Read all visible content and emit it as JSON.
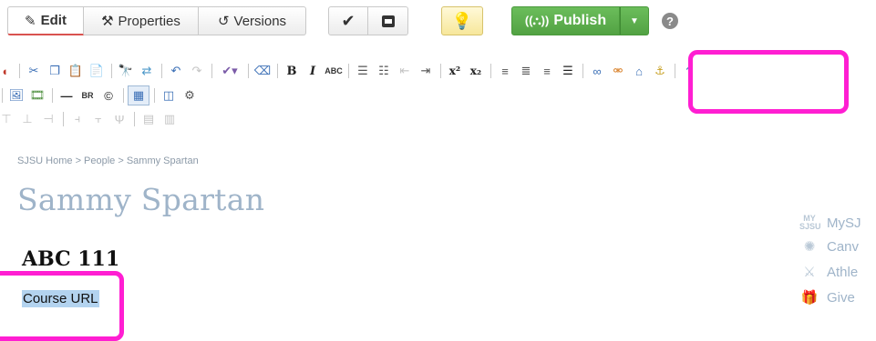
{
  "topbar": {
    "edit_label": "Edit",
    "properties_label": "Properties",
    "versions_label": "Versions",
    "publish_label": "Publish",
    "help_glyph": "?"
  },
  "icons": {
    "edit": "pencil-icon",
    "properties": "tools-icon",
    "versions": "history-icon",
    "confirm": "checkmark-icon",
    "save": "save-draft-icon",
    "suggest": "lightbulb-icon",
    "publish": "broadcast-icon",
    "publish_menu": "chevron-down-icon",
    "help": "help-icon"
  },
  "editor_toolbar": {
    "bold": "B",
    "italic": "I",
    "spellcheck": "ABC",
    "superscript": "x²",
    "subscript": "x₂",
    "break": "BR"
  },
  "breadcrumb": "SJSU Home > People > Sammy Spartan",
  "page": {
    "title": "Sammy Spartan",
    "heading": "ABC 111",
    "course_url": "Course URL"
  },
  "side_links": [
    {
      "label": "MySJ",
      "icon": "mysjsu-icon"
    },
    {
      "label": "Canv",
      "icon": "canvas-icon"
    },
    {
      "label": "Athle",
      "icon": "athletics-icon"
    },
    {
      "label": "Give",
      "icon": "gift-icon"
    }
  ],
  "colors": {
    "publish_green": "#5cb04c",
    "highlight_magenta": "#ff1ed2",
    "title_blue": "#9fb4c9",
    "selection": "#b3d3ef"
  }
}
